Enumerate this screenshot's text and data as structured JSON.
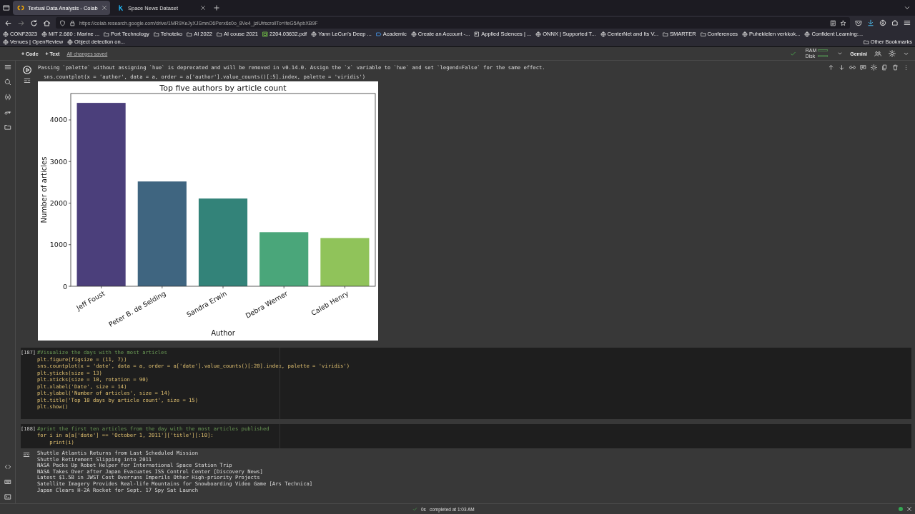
{
  "browser": {
    "tabs": [
      {
        "label": "Textual Data Analysis - Colab",
        "selected": true,
        "kind": "colab"
      },
      {
        "label": "Space News Dataset",
        "selected": false,
        "kind": "kaggle"
      }
    ],
    "url": "https://colab.research.google.com/drive/1MR9XeJyXJSmnO6Perx6s0o_8Ve4_jziU#scrollTo=lfeG5ApbXB9F",
    "bookmarks": [
      {
        "label": "CONF2023",
        "kind": "globe"
      },
      {
        "label": "MIT 2.680 : Marine ...",
        "kind": "globe"
      },
      {
        "label": "Port Technology",
        "kind": "folder"
      },
      {
        "label": "Tehoteko",
        "kind": "folder"
      },
      {
        "label": "AI 2022",
        "kind": "folder"
      },
      {
        "label": "AI couse 2021",
        "kind": "folder"
      },
      {
        "label": "2204.03632.pdf",
        "kind": "pdf"
      },
      {
        "label": "Yann LeCun's Deep ...",
        "kind": "globe"
      },
      {
        "label": "Academic",
        "kind": "tag"
      },
      {
        "label": "Create an Account -...",
        "kind": "globe"
      },
      {
        "label": "Applied Sciences | ...",
        "kind": "page"
      },
      {
        "label": "ONNX | Supported T...",
        "kind": "globe"
      },
      {
        "label": "CenterNet and Its V...",
        "kind": "globe"
      },
      {
        "label": "SMARTER",
        "kind": "folder"
      },
      {
        "label": "Conferences",
        "kind": "folder"
      },
      {
        "label": "Puhekielen verkkok...",
        "kind": "globe"
      },
      {
        "label": "Confident Learning:...",
        "kind": "globe"
      },
      {
        "label": "Venues | OpenReview",
        "kind": "globe"
      },
      {
        "label": "Object detection on...",
        "kind": "globe"
      }
    ],
    "other_bookmarks": "Other Bookmarks"
  },
  "toolbar": {
    "add_code": "+ Code",
    "add_text": "+ Text",
    "save_status": "All changes saved",
    "ram": "RAM",
    "disk": "Disk",
    "gemini": "Gemini"
  },
  "output_cell": {
    "warning": "Passing `palette` without assigning `hue` is deprecated and will be removed in v0.14.0. Assign the `x` variable to `hue` and set `legend=False` for the same effect.",
    "echo": "sns.countplot(x = 'author', data = a, order = a['author'].value_counts()[:5].index, palette = 'viridis')",
    "chart_data": {
      "type": "bar",
      "title": "Top five authors by article count",
      "xlabel": "Author",
      "ylabel": "Number of articles",
      "categories": [
        "Jeff Foust",
        "Peter B. de Selding",
        "Sandra Erwin",
        "Debra Werner",
        "Caleb Henry"
      ],
      "values": [
        4410,
        2520,
        2110,
        1300,
        1160
      ],
      "yticks": [
        0,
        1000,
        2000,
        3000,
        4000
      ],
      "ylim": [
        0,
        4635
      ]
    }
  },
  "cells": [
    {
      "count": "[187]",
      "lines": [
        {
          "kind": "comment",
          "text": "#Visualize the days with the most articles"
        },
        {
          "kind": "code",
          "text": "plt.figure(figsize = (11, 7))"
        },
        {
          "kind": "code",
          "text": "sns.countplot(x = 'date', data = a, order = a['date'].value_counts()[:20].index, palette = 'viridis')"
        },
        {
          "kind": "code",
          "text": "plt.yticks(size = 13)"
        },
        {
          "kind": "code",
          "text": "plt.xticks(size = 10, rotation = 90)"
        },
        {
          "kind": "code",
          "text": "plt.xlabel('Date', size = 14)"
        },
        {
          "kind": "code",
          "text": "plt.ylabel('Number of articles', size = 14)"
        },
        {
          "kind": "code",
          "text": "plt.title('Top 10 days by article count', size = 15)"
        },
        {
          "kind": "code",
          "text": "plt.show()"
        }
      ]
    },
    {
      "count": "[188]",
      "lines": [
        {
          "kind": "comment",
          "text": "#print the first ten articles from the day with the most articles published"
        },
        {
          "kind": "code",
          "text": "for i in a[a['date'] == 'October 1, 2011']['title'][:10]:"
        },
        {
          "kind": "code",
          "text": "    print(i)"
        }
      ],
      "output": [
        "Shuttle Atlantis Returns from Last Scheduled Mission",
        "Shuttle Retirement Slipping into 2011",
        "NASA Packs Up Robot Helper for International Space Station Trip",
        "NASA Takes Over after Japan Evacuates ISS Control Center [Discovery News]",
        "Latest $1.5B in JWST Cost Overruns Imperils Other High-priority Projects",
        "Satellite Imagery Provides Real-life Mountains for Snowboarding Video Game [Ars Technica]",
        "Japan Clears H-2A Rocket for Sept. 17 Spy Sat Launch"
      ]
    }
  ],
  "status_bar": {
    "duration": "0s",
    "message": "completed at 1:03 AM"
  }
}
